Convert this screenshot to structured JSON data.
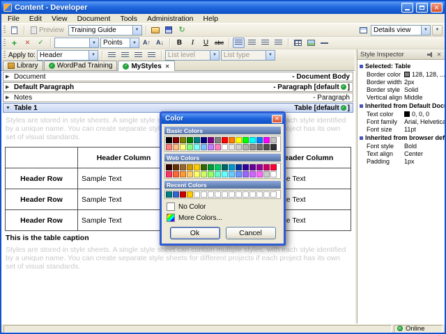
{
  "window": {
    "title": "Content - Developer",
    "status": "Online"
  },
  "menu": {
    "items": [
      "File",
      "Edit",
      "View",
      "Document",
      "Tools",
      "Administration",
      "Help"
    ]
  },
  "toolbars": {
    "preview_label": "Preview",
    "content_combo": "Training Guide",
    "details_view_combo": "Details view",
    "points_combo": "Points",
    "apply_to_label": "Apply to:",
    "apply_to_combo": "Header",
    "list_level_combo": "List level",
    "list_type_combo": "List type",
    "bold_label": "B",
    "italic_label": "I",
    "underline_label": "U",
    "strike_label": "abc",
    "grow_font_label": "A↑",
    "shrink_font_label": "A↓"
  },
  "tabs": [
    {
      "label": "Library"
    },
    {
      "label": "WordPad Training"
    },
    {
      "label": "MyStyles"
    }
  ],
  "style_rows": [
    {
      "name": "Document",
      "kind": "- Document Body"
    },
    {
      "name": "Default Paragraph",
      "kind_prefix": "- Paragraph [default",
      "kind_suffix": "]"
    },
    {
      "name": "Notes",
      "kind": "- Paragraph"
    },
    {
      "name": "Table 1",
      "kind_prefix": "Table [default",
      "kind_suffix": "]"
    }
  ],
  "preview": {
    "paragraph": "Styles are stored in style sheets. A single style sheet can contain multiple styles, with each style identified by a unique name. You can create separate style sheets for different projects if each project has its own set of visual standards.",
    "table": {
      "columns": [
        "Header Column",
        "Header Column",
        "Header Column"
      ],
      "rows": [
        {
          "label": "Header Row",
          "cells": [
            "Sample Text",
            "Sample Text",
            "Sample Text"
          ]
        },
        {
          "label": "Header Row",
          "cells": [
            "Sample Text",
            "Sample Text",
            "Sample Text"
          ]
        },
        {
          "label": "Header Row",
          "cells": [
            "Sample Text",
            "Sample Text",
            "Sample Text"
          ]
        }
      ]
    },
    "caption": "This is the table caption",
    "paragraph2": "Styles are stored in style sheets. A single style sheet can contain multiple styles, with each style identified by a unique name. You can create separate style sheets for different projects if each project has its own set of visual standards."
  },
  "color_dialog": {
    "title": "Color",
    "sections": {
      "basic": {
        "label": "Basic Colors",
        "rows": [
          [
            "#000000",
            "#800000",
            "#808000",
            "#008000",
            "#008080",
            "#000080",
            "#800080",
            "#808080",
            "#FF0000",
            "#FF8000",
            "#FFFF00",
            "#00FF00",
            "#00FFFF",
            "#0080FF",
            "#FF00FF",
            "#C0C0C0"
          ],
          [
            "#FF8080",
            "#FFC080",
            "#FFFF80",
            "#80FF80",
            "#80FFFF",
            "#80C0FF",
            "#C080FF",
            "#FF80C0",
            "#FFFFFF",
            "#E8E8E8",
            "#D0D0D0",
            "#B0B0B0",
            "#909090",
            "#707070",
            "#505050",
            "#303030"
          ]
        ]
      },
      "web": {
        "label": "Web Colors",
        "rows": [
          [
            "#330000",
            "#663300",
            "#996633",
            "#CC9900",
            "#FFCC00",
            "#336600",
            "#009933",
            "#00CC66",
            "#006666",
            "#0099CC",
            "#003399",
            "#330099",
            "#660099",
            "#990099",
            "#CC0066",
            "#FF0033"
          ],
          [
            "#FF3366",
            "#FF6633",
            "#FF9933",
            "#FFCC66",
            "#FFFF66",
            "#CCFF66",
            "#99FF66",
            "#66FFCC",
            "#66FFFF",
            "#66CCFF",
            "#6699FF",
            "#9966FF",
            "#CC66FF",
            "#FF66FF",
            "#CCCCCC",
            "#FFFFFF"
          ]
        ]
      },
      "recent": {
        "label": "Recent Colors",
        "rows": [
          [
            "#008080",
            "#3366CC",
            "#CC0000",
            "#FFCC00",
            "#FFFFFF",
            "#FFFFFF",
            "#FFFFFF",
            "#FFFFFF",
            "#FFFFFF",
            "#FFFFFF",
            "#FFFFFF",
            "#FFFFFF",
            "#FFFFFF",
            "#FFFFFF",
            "#FFFFFF",
            "#FFFFFF"
          ]
        ]
      }
    },
    "no_color_label": "No Color",
    "more_colors_label": "More Colors...",
    "ok_label": "Ok",
    "cancel_label": "Cancel"
  },
  "inspector": {
    "title": "Style Inspector",
    "groups": [
      {
        "header": "Selected: Table",
        "props": [
          {
            "label": "Border color",
            "value": "128, 128, ...",
            "swatch": "#808080"
          },
          {
            "label": "Border width",
            "value": "2px"
          },
          {
            "label": "Border style",
            "value": "Solid"
          },
          {
            "label": "Vertical align",
            "value": "Middle"
          }
        ]
      },
      {
        "header": "Inherited from Default Documen",
        "props": [
          {
            "label": "Text color",
            "value": "0, 0, 0",
            "swatch": "#000000"
          },
          {
            "label": "Font family",
            "value": "Arial, Helvetica,..."
          },
          {
            "label": "Font size",
            "value": "11pt"
          }
        ]
      },
      {
        "header": "Inherited from browser defaults",
        "props": [
          {
            "label": "Font style",
            "value": "Bold"
          },
          {
            "label": "Text align",
            "value": "Center"
          },
          {
            "label": "Padding",
            "value": "1px"
          }
        ]
      }
    ]
  },
  "colors": {
    "titlebar_blue": "#1966DE",
    "selection_blue": "#C8D7F3",
    "check_green": "#23A13A",
    "gray_preview_text": "#C9C9C9"
  }
}
